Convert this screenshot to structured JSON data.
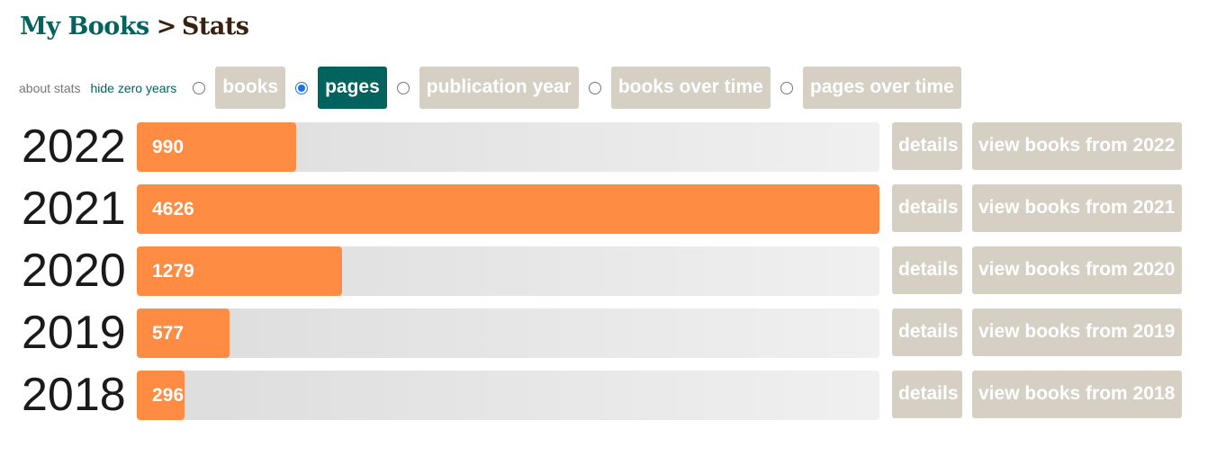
{
  "breadcrumb": {
    "home": "My Books",
    "separator": ">",
    "current": "Stats"
  },
  "toolbar": {
    "about_link": "about stats",
    "hide_link": "hide zero years",
    "options": [
      {
        "label": "books",
        "selected": false
      },
      {
        "label": "pages",
        "selected": true
      },
      {
        "label": "publication year",
        "selected": false
      },
      {
        "label": "books over time",
        "selected": false
      },
      {
        "label": "pages over time",
        "selected": false
      }
    ]
  },
  "chart_data": {
    "type": "bar",
    "orientation": "horizontal",
    "categories": [
      "2022",
      "2021",
      "2020",
      "2019",
      "2018"
    ],
    "values": [
      990,
      4626,
      1279,
      577,
      296
    ],
    "max": 4626
  },
  "rows": [
    {
      "year": "2022",
      "value": "990",
      "details": "details",
      "view": "view books from 2022"
    },
    {
      "year": "2021",
      "value": "4626",
      "details": "details",
      "view": "view books from 2021"
    },
    {
      "year": "2020",
      "value": "1279",
      "details": "details",
      "view": "view books from 2020"
    },
    {
      "year": "2019",
      "value": "577",
      "details": "details",
      "view": "view books from 2019"
    },
    {
      "year": "2018",
      "value": "296",
      "details": "details",
      "view": "view books from 2018"
    }
  ],
  "colors": {
    "accent": "#00635d",
    "bar_fill": "#ff8c42",
    "button_bg": "#d6d0c4",
    "selected_radio": "#1a73e8"
  }
}
